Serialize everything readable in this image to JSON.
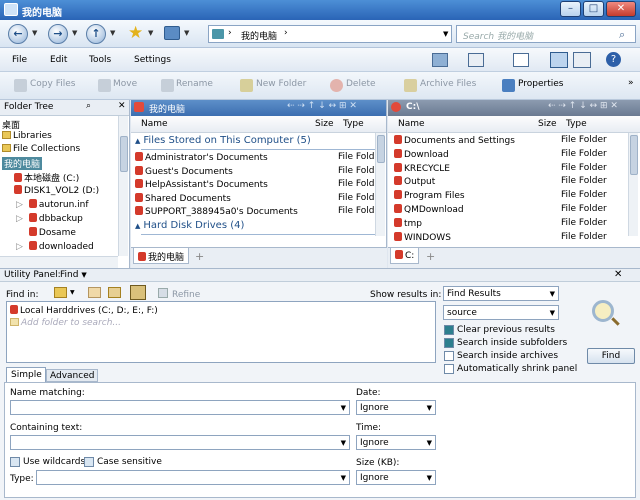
{
  "window": {
    "title": "我的电脑"
  },
  "address": {
    "path": "我的电脑",
    "sep": "›",
    "search_placeholder": "Search 我的电脑"
  },
  "menubar": {
    "items": [
      "File",
      "Edit",
      "Tools",
      "Settings"
    ]
  },
  "toolbar": {
    "copy": "Copy Files",
    "move": "Move",
    "rename": "Rename",
    "new_folder": "New Folder",
    "delete": "Delete",
    "archive": "Archive Files",
    "properties": "Properties"
  },
  "tree": {
    "title": "Folder Tree",
    "items": [
      "桌面",
      "Libraries",
      "File Collections",
      "我的电脑",
      "本地磁盘 (C:)",
      "DISK1_VOL2 (D:)",
      "autorun.inf",
      "dbbackup",
      "Dosame",
      "downloaded"
    ]
  },
  "left_pane": {
    "title": "我的电脑",
    "col_name": "Name",
    "col_size": "Size",
    "col_type": "Type",
    "group1": "Files Stored on This Computer (5)",
    "group2": "Hard Disk Drives (4)",
    "rows": [
      {
        "name": "Administrator's Documents",
        "type": "File Folde"
      },
      {
        "name": "Guest's Documents",
        "type": "File Folde"
      },
      {
        "name": "HelpAssistant's Documents",
        "type": "File Folde"
      },
      {
        "name": "Shared Documents",
        "type": "File Folde"
      },
      {
        "name": "SUPPORT_388945a0's Documents",
        "type": "File Folde"
      }
    ],
    "tab": "我的电脑"
  },
  "right_pane": {
    "title": "C:\\",
    "col_name": "Name",
    "col_size": "Size",
    "col_type": "Type",
    "rows": [
      {
        "name": "Documents and Settings",
        "type": "File Folder"
      },
      {
        "name": "Download",
        "type": "File Folder"
      },
      {
        "name": "KRECYCLE",
        "type": "File Folder"
      },
      {
        "name": "Output",
        "type": "File Folder"
      },
      {
        "name": "Program Files",
        "type": "File Folder"
      },
      {
        "name": "QMDownload",
        "type": "File Folder"
      },
      {
        "name": "tmp",
        "type": "File Folder"
      },
      {
        "name": "WINDOWS",
        "type": "File Folder"
      }
    ],
    "tab": "C:"
  },
  "utility": {
    "header": "Utility Panel:",
    "mode": "Find",
    "find_in_label": "Find in:",
    "refine": "Refine",
    "location_item": "Local Harddrives (C:, D:, E:, F:)",
    "add_folder_placeholder": "Add folder to search...",
    "show_results_label": "Show results in:",
    "results_value": "Find Results",
    "source_value": "source",
    "checks": [
      {
        "label": "Clear previous results",
        "checked": true
      },
      {
        "label": "Search inside subfolders",
        "checked": true
      },
      {
        "label": "Search inside archives",
        "checked": false
      },
      {
        "label": "Automatically shrink panel",
        "checked": false
      }
    ],
    "find_button": "Find",
    "tabs": [
      "Simple",
      "Advanced"
    ],
    "name_matching": "Name matching:",
    "containing_text": "Containing text:",
    "use_wildcards": "Use wildcards",
    "case_sensitive": "Case sensitive",
    "type_label": "Type:",
    "date_label": "Date:",
    "time_label": "Time:",
    "size_label": "Size (KB):",
    "ignore": "Ignore"
  }
}
